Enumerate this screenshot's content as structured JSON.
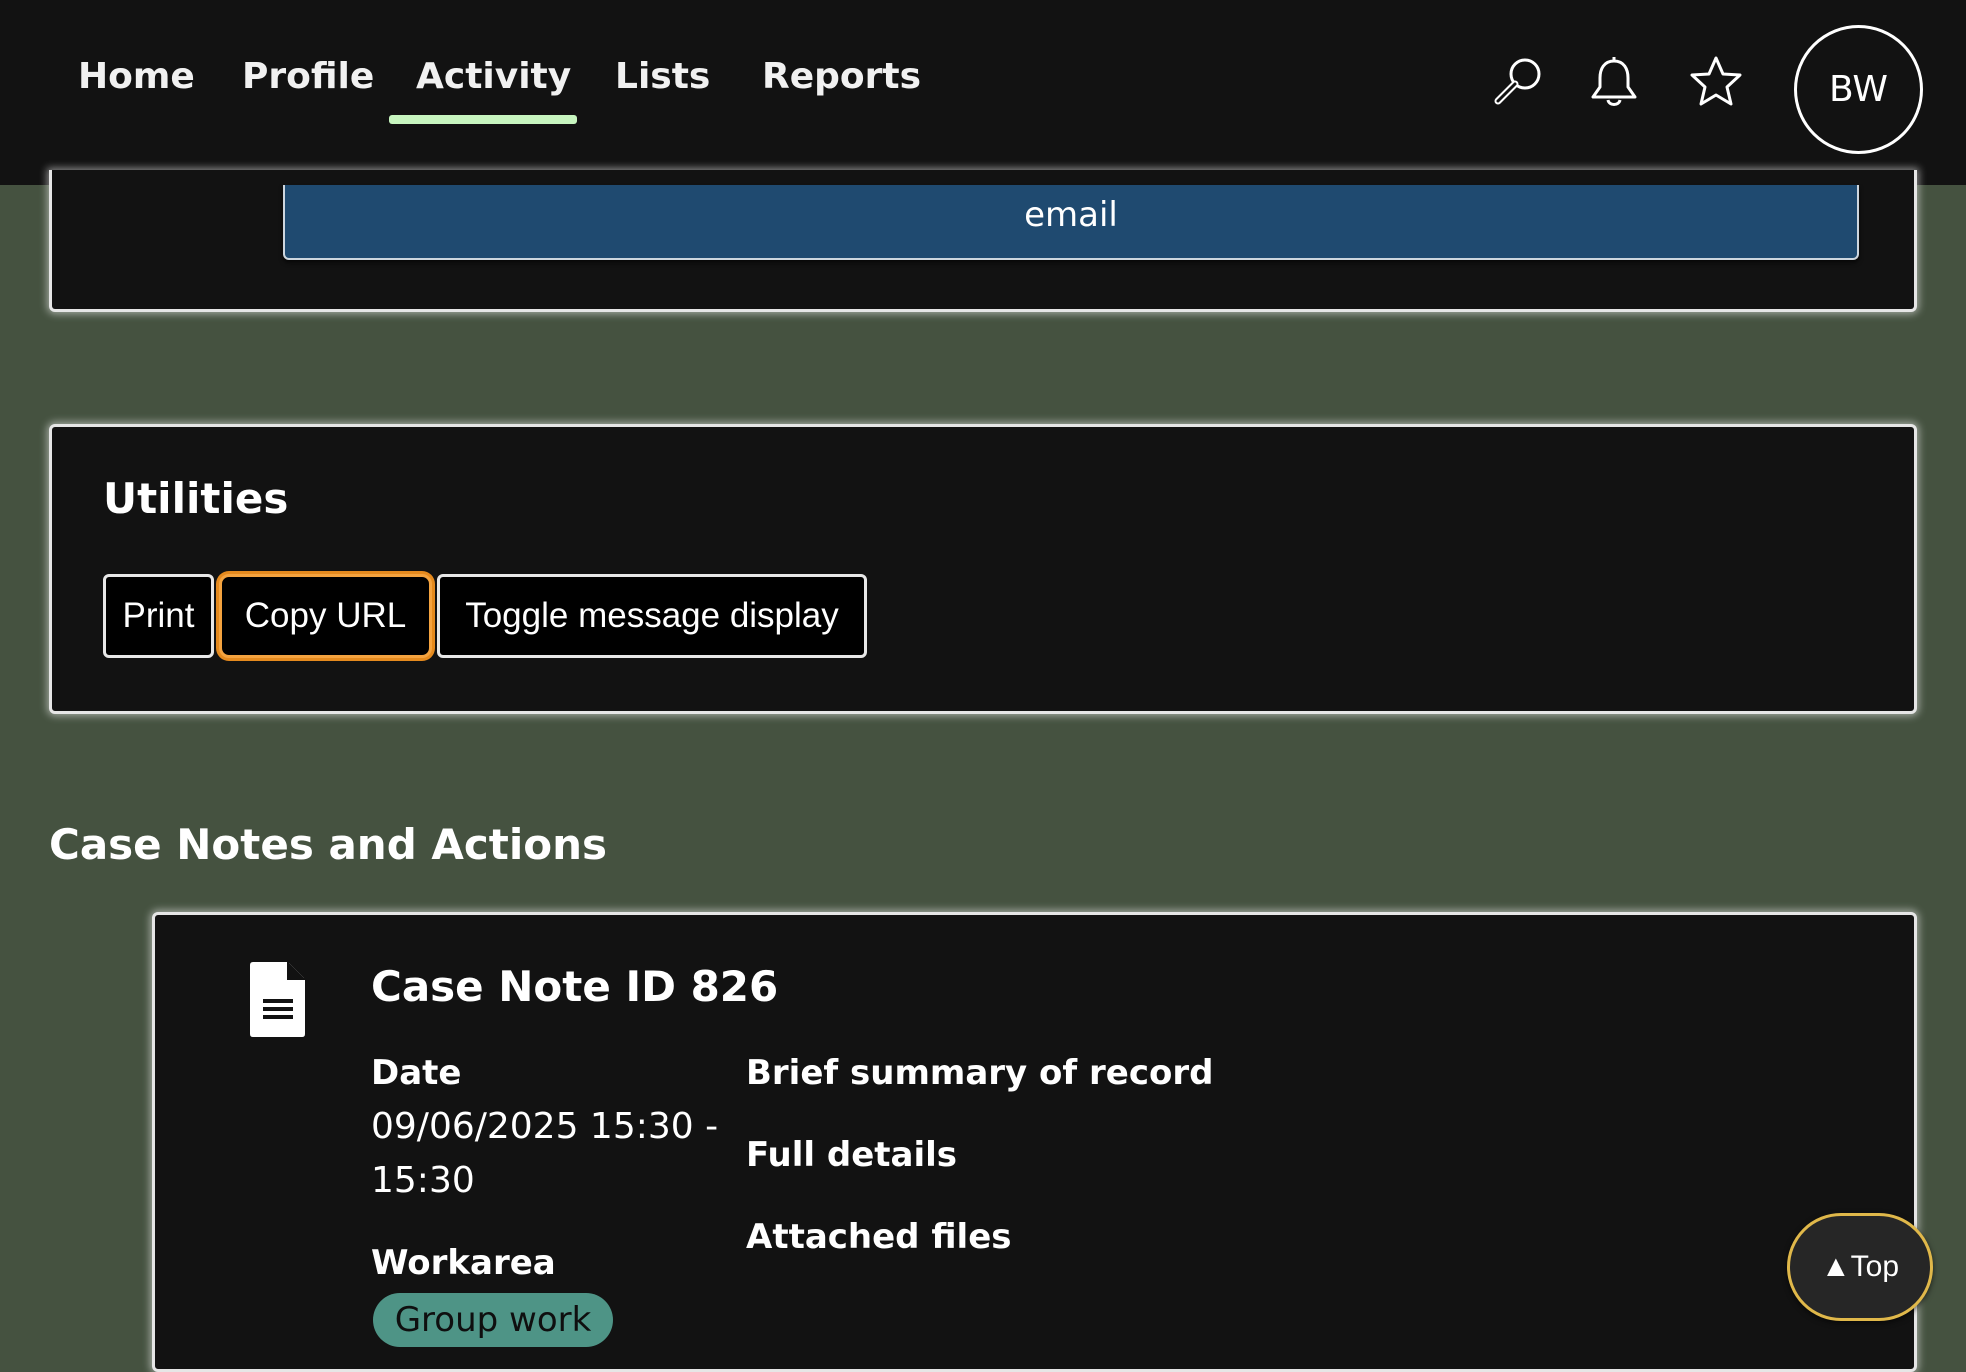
{
  "nav": {
    "items": [
      {
        "label": "Home"
      },
      {
        "label": "Profile"
      },
      {
        "label": "Activity",
        "active": true
      },
      {
        "label": "Lists"
      },
      {
        "label": "Reports"
      }
    ],
    "icons": [
      "search-icon",
      "bell-icon",
      "star-icon"
    ],
    "avatar_initials": "BW"
  },
  "email_button": {
    "label": "email"
  },
  "utilities": {
    "title": "Utilities",
    "buttons": [
      {
        "label": "Print"
      },
      {
        "label": "Copy URL",
        "focused": true
      },
      {
        "label": "Toggle message display"
      }
    ]
  },
  "case_notes": {
    "title": "Case Notes and Actions",
    "note": {
      "title": "Case Note ID 826",
      "date_label": "Date",
      "date_value": "09/06/2025 15:30 - 15:30",
      "workarea_label": "Workarea",
      "workarea_value": "Group work",
      "summary_label": "Brief summary of record",
      "details_label": "Full details",
      "files_label": "Attached files"
    }
  },
  "top_button": {
    "label": "▲Top"
  },
  "colors": {
    "background": "#455240",
    "nav_bg": "#121212",
    "accent_underline": "#c7f5bf",
    "focus_ring": "#f4a33f",
    "email_button": "#1f4a70",
    "badge": "#4e9486"
  }
}
